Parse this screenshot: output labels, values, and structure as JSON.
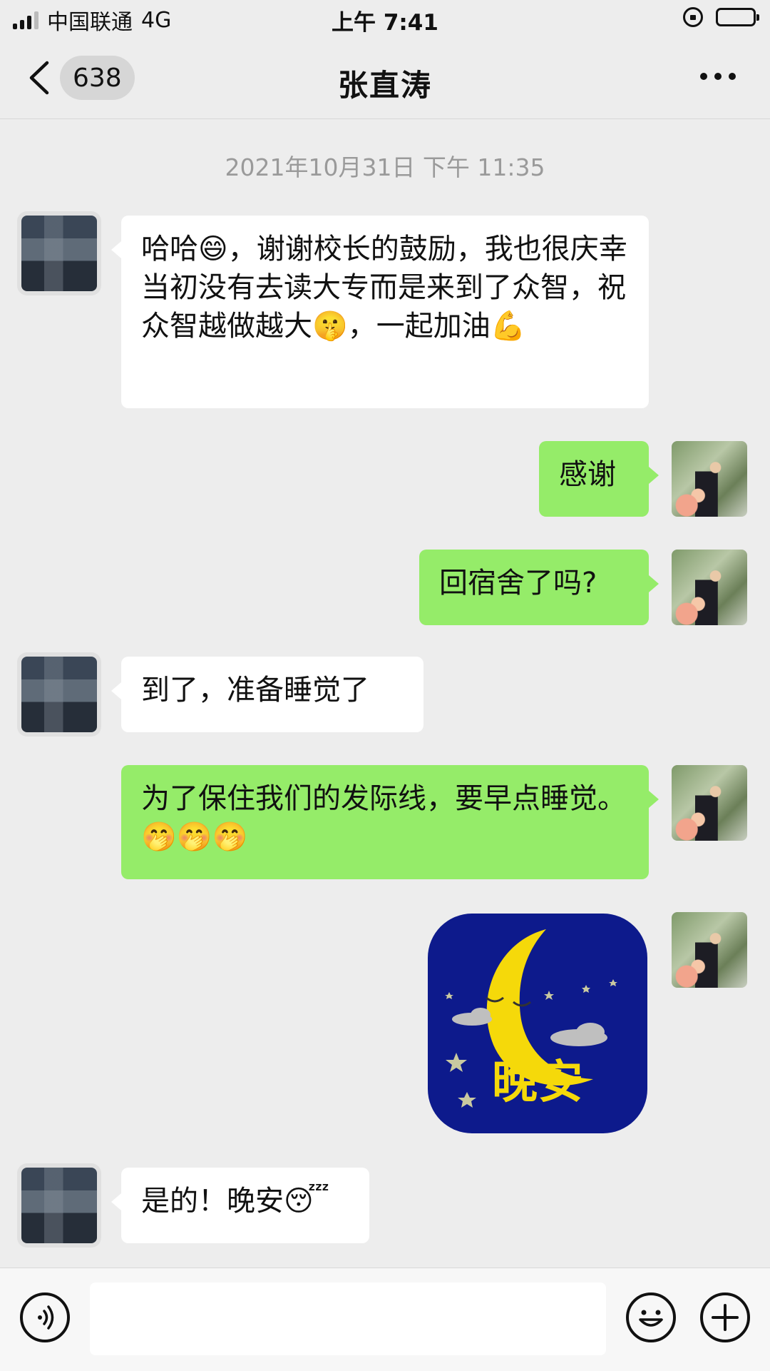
{
  "status_bar": {
    "carrier": "中国联通",
    "network": "4G",
    "time": "上午 7:41"
  },
  "nav": {
    "back_count": "638",
    "title": "张直涛",
    "more_icon": "more-dots-icon"
  },
  "timestamp": "2021年10月31日 下午 11:35",
  "messages": [
    {
      "side": "other",
      "text": "哈哈😄，谢谢校长的鼓励，我也很庆幸当初没有去读大专而是来到了众智，祝众智越做越大🤫，一起加油💪"
    },
    {
      "side": "me",
      "text": "感谢"
    },
    {
      "side": "me",
      "text": "回宿舍了吗?"
    },
    {
      "side": "other",
      "text": "到了，准备睡觉了"
    },
    {
      "side": "me",
      "text": "为了保住我们的发际线，要早点睡觉。🤭🤭🤭"
    },
    {
      "side": "me",
      "sticker_text": "晚安"
    },
    {
      "side": "other",
      "text": "是的！晚安😴"
    }
  ],
  "input_bar": {
    "voice_icon": "voice-icon",
    "emoji_icon": "emoji-icon",
    "plus_icon": "plus-icon",
    "input_value": ""
  },
  "colors": {
    "background": "#ededed",
    "bubble_me": "#95ec69",
    "bubble_other": "#ffffff",
    "sticker_bg": "#0d1a8c",
    "moon": "#f5d90a"
  }
}
